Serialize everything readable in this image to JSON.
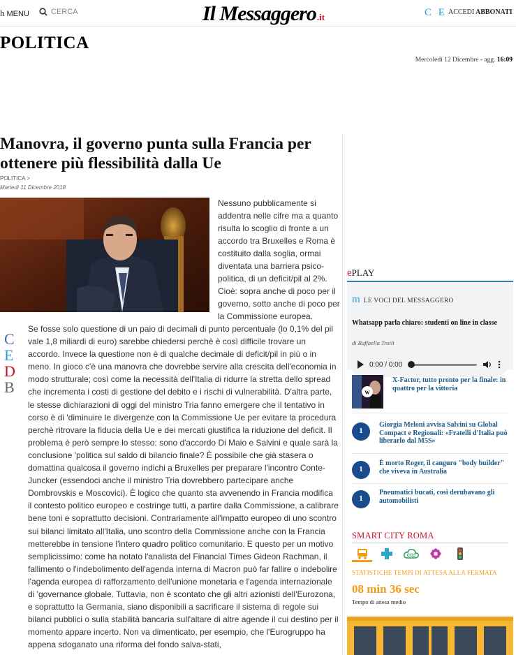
{
  "header": {
    "menu_glyph": "h",
    "menu_label": "MENU",
    "search_label": "CERCA",
    "logo_text": "Il Messaggero",
    "logo_suffix": ".it",
    "ce_label": "C E",
    "login_label": "ACCEDI",
    "subscribe_label": "ABBONATI"
  },
  "section": {
    "title": "POLITICA",
    "date_prefix": "Mercoledì 12 Dicembre - agg.",
    "updated_time": "16:09"
  },
  "article": {
    "headline": "Manovra, il governo punta sulla Francia per ottenere più flessibilità dalla Ue",
    "breadcrumb": "POLITICA >",
    "date": "Martedì 11 Dicembre 2018",
    "lead": "Nessuno pubblicamente si addentra nelle cifre ma a quanto risulta lo scoglio di fronte a un accordo tra Bruxelles e Roma è costituito dalla soglia, ormai diventata una barriera psico-politica, di un deficit/pil al 2%. Cioè: sopra anche di poco per il governo, sotto anche di poco per la Commissione europea.",
    "body": "Se fosse solo questione di un paio di decimali di punto percentuale (lo 0,1% del pil vale 1,8 miliardi di euro) sarebbe chiedersi perchè è così difficile trovare un accordo. Invece la questione non è di qualche decimale di deficit/pil in più o in meno. In gioco c'è una manovra che dovrebbe servire alla crescita dell'economia in modo strutturale; così come la necessità dell'Italia di ridurre la stretta dello spread che incrementa i costi di gestione del debito e i rischi di vulnerabilità. D'altra parte, le stesse dichiarazioni di oggi del ministro Tria fanno emergere che il tentativo in corso è di 'diminuire le divergenze con la Commissione Ue per evitare la procedura perchè ritrovare la fiducia della Ue e dei mercati giustifica la riduzione del deficit. Il problema è però sempre lo stesso: sono d'accordo Di Maio e Salvini e quale sarà la conclusione 'politica sul saldo di bilancio finale? È possibile che già stasera o domattina qualcosa il governo indichi a Bruxelles per preparare l'incontro Conte-Juncker (essendoci anche il ministro Tria dovrebbero partecipare anche Dombrovskis e Moscovici). È logico che quanto sta avvenendo in Francia modifica il contesto politico europeo e costringe tutti, a partire dalla Commissione, a calibrare bene toni e soprattutto decisioni. Contrariamente all'impatto europeo di uno scontro sui bilanci limitato all'Italia, uno scontro della Commissione anche con la Francia metterebbe in tensione l'intero quadro politico comunitario. E questo per un motivo semplicissimo: come ha notato l'analista del Financial Times Gideon Rachman, il fallimento o l'indebolimento dell'agenda interna di Macron può far fallire o indebolire l'agenda europea di rafforzamento dell'unione monetaria e l'agenda internazionale di 'governance globale. Tuttavia, non è scontato che gli altri azionisti dell'Eurozona, e soprattutto la Germania, siano disponibili a sacrificare il sistema di regole sui bilanci pubblici o sulla stabilità bancaria sull'altare di altre agende il cui destino per il momento appare incerto. Non va dimenticato, per esempio, che l'Eurogruppo ha appena sdoganato una riforma del fondo salva-stati,",
    "share_letters": [
      "C",
      "E",
      "D",
      "B"
    ],
    "share_colors": [
      "#3a6fb0",
      "#2c9fd6",
      "#c8102e",
      "#666666"
    ]
  },
  "sidebar": {
    "eplay_prefix": "e",
    "eplay_label": "PLAY",
    "voci": {
      "glyph": "m",
      "label": "LE VOCI DEL MESSAGGERO",
      "title": "Whatsapp parla chiaro: studenti on line in classe",
      "author": "di Raffaella Troili",
      "time": "0:00 / 0:00"
    },
    "featured": {
      "thumb_letter": "w",
      "title": "X-Factor, tutto pronto per la finale: in quattro per la vittoria"
    },
    "stories": [
      {
        "num": "1",
        "title": "Giorgia Meloni avvisa Salvini su Global Compact e Regionali: «Fratelli d'Italia può liberarlo dal M5S»"
      },
      {
        "num": "1",
        "title": "È morto Roger, il canguro \"body builder\" che viveva in Australia"
      },
      {
        "num": "1",
        "title": "Pneumatici bucati, così derubavano gli automobilisti"
      }
    ],
    "smart_city": {
      "title": "SMART CITY ROMA",
      "stat_heading": "STATISTICHE TEMPI DI ATTESA ALLA FERMATA",
      "wait_value": "08 min 36 sec",
      "wait_label": "Tempo di attesa medio",
      "icon_names": [
        "bus-icon",
        "health-cross-icon",
        "co2-icon",
        "flower-icon",
        "traffic-light-icon"
      ],
      "accent": "#f39c12"
    }
  },
  "colors": {
    "brand_red": "#c8102e",
    "link_blue": "#1a5a87",
    "accent_orange": "#f39c12"
  }
}
